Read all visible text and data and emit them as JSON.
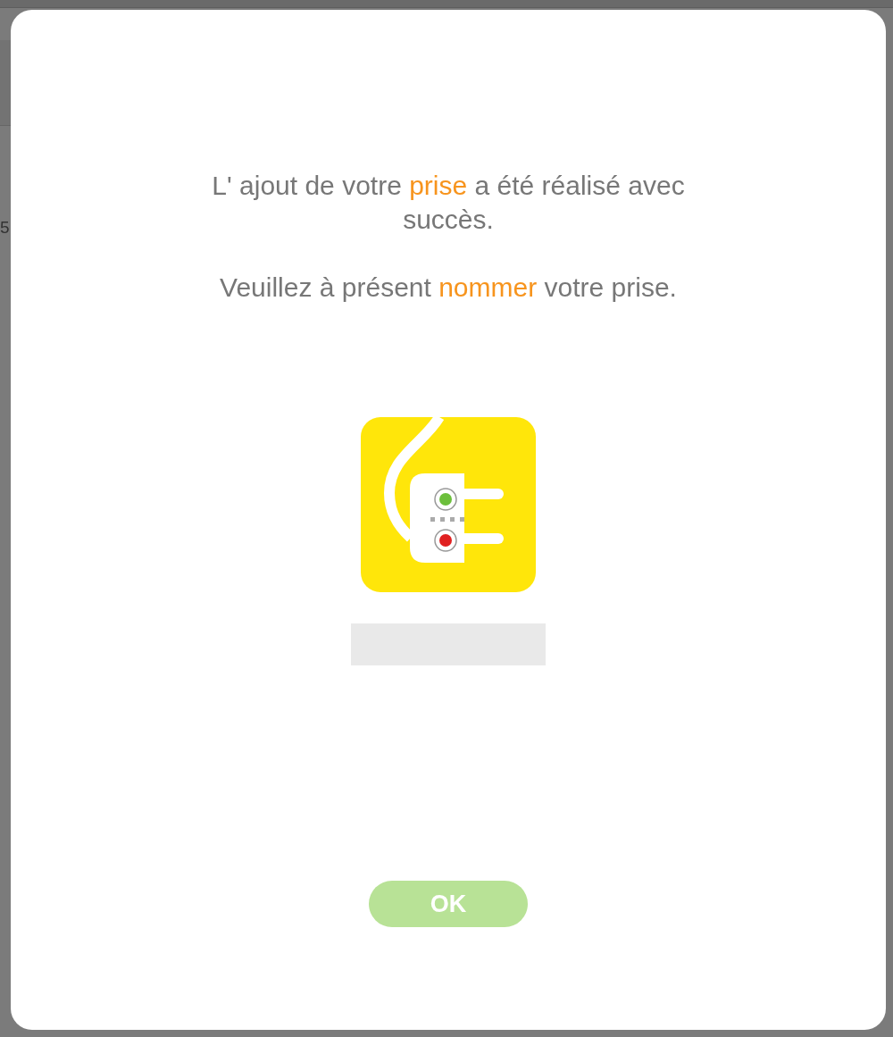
{
  "background": {
    "fragment": "5"
  },
  "dialog": {
    "messages": [
      {
        "segments": [
          {
            "text": "L' ajout de votre ",
            "highlight": false
          },
          {
            "text": "prise",
            "highlight": true
          },
          {
            "text": " a été réalisé avec succès.",
            "highlight": false
          }
        ]
      },
      {
        "segments": [
          {
            "text": "Veuillez à présent ",
            "highlight": false
          },
          {
            "text": "nommer",
            "highlight": true
          },
          {
            "text": " votre prise.",
            "highlight": false
          }
        ]
      }
    ],
    "device": {
      "kind": "plug"
    },
    "ok_button": {
      "label": "OK",
      "disabled": true
    }
  }
}
